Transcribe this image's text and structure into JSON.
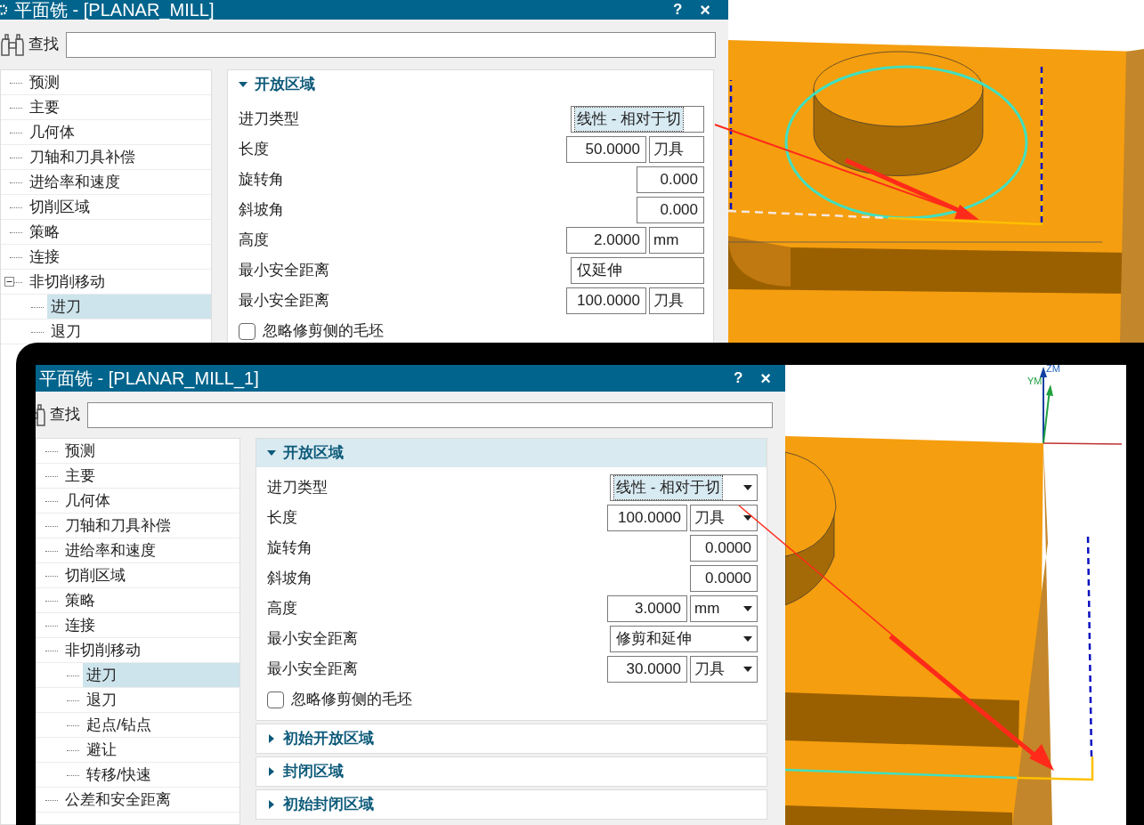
{
  "top_screen": {
    "dialog": {
      "title": "平面铣 - [PLANAR_MILL]",
      "help": "?",
      "close": "×",
      "search_label": "查找",
      "tree": [
        {
          "label": "预测",
          "selected": false
        },
        {
          "label": "主要",
          "selected": false
        },
        {
          "label": "几何体",
          "selected": false
        },
        {
          "label": "刀轴和刀具补偿",
          "selected": false
        },
        {
          "label": "进给率和速度",
          "selected": false
        },
        {
          "label": "切削区域",
          "selected": false
        },
        {
          "label": "策略",
          "selected": false
        },
        {
          "label": "连接",
          "selected": false
        },
        {
          "label": "非切削移动",
          "selected": false,
          "expanded": true,
          "children": [
            {
              "label": "进刀",
              "selected": true
            },
            {
              "label": "退刀",
              "selected": false
            }
          ]
        }
      ],
      "section": {
        "title": "开放区域",
        "expanded": true,
        "highlighted": false,
        "fields": [
          {
            "label": "进刀类型",
            "kind": "dropdown",
            "value": "线性 - 相对于切",
            "focused": true
          },
          {
            "label": "长度",
            "kind": "number_unit",
            "value": "50.0000",
            "unit": "刀具"
          },
          {
            "label": "旋转角",
            "kind": "number",
            "value": "0.000"
          },
          {
            "label": "斜坡角",
            "kind": "number",
            "value": "0.000"
          },
          {
            "label": "高度",
            "kind": "number_unit",
            "value": "2.0000",
            "unit": "mm"
          },
          {
            "label": "最小安全距离",
            "kind": "dropdown",
            "value": "仅延伸",
            "focused": false
          },
          {
            "label": "最小安全距离",
            "kind": "number_unit",
            "value": "100.0000",
            "unit": "刀具"
          }
        ],
        "checkbox": {
          "label": "忽略修剪侧的毛坯",
          "checked": false
        }
      }
    }
  },
  "bottom_screen": {
    "dialog": {
      "title": "平面铣 - [PLANAR_MILL_1]",
      "help": "?",
      "close": "×",
      "search_label": "查找",
      "tree": [
        {
          "label": "预测",
          "selected": false
        },
        {
          "label": "主要",
          "selected": false
        },
        {
          "label": "几何体",
          "selected": false
        },
        {
          "label": "刀轴和刀具补偿",
          "selected": false
        },
        {
          "label": "进给率和速度",
          "selected": false
        },
        {
          "label": "切削区域",
          "selected": false
        },
        {
          "label": "策略",
          "selected": false
        },
        {
          "label": "连接",
          "selected": false
        },
        {
          "label": "非切削移动",
          "selected": false,
          "children": [
            {
              "label": "进刀",
              "selected": true
            },
            {
              "label": "退刀",
              "selected": false
            },
            {
              "label": "起点/钻点",
              "selected": false
            },
            {
              "label": "避让",
              "selected": false
            },
            {
              "label": "转移/快速",
              "selected": false
            }
          ]
        },
        {
          "label": "公差和安全距离",
          "selected": false
        }
      ],
      "section": {
        "title": "开放区域",
        "expanded": true,
        "highlighted": true,
        "fields": [
          {
            "label": "进刀类型",
            "kind": "dropdown",
            "value": "线性 - 相对于切",
            "focused": true
          },
          {
            "label": "长度",
            "kind": "number_unit",
            "value": "100.0000",
            "unit": "刀具"
          },
          {
            "label": "旋转角",
            "kind": "number",
            "value": "0.0000"
          },
          {
            "label": "斜坡角",
            "kind": "number",
            "value": "0.0000"
          },
          {
            "label": "高度",
            "kind": "number_unit",
            "value": "3.0000",
            "unit": "mm"
          },
          {
            "label": "最小安全距离",
            "kind": "dropdown",
            "value": "修剪和延伸",
            "focused": false
          },
          {
            "label": "最小安全距离",
            "kind": "number_unit",
            "value": "30.0000",
            "unit": "刀具"
          }
        ],
        "checkbox": {
          "label": "忽略修剪侧的毛坯",
          "checked": false
        }
      },
      "collapsed_sections": [
        {
          "title": "初始开放区域",
          "expanded": false
        },
        {
          "title": "封闭区域",
          "expanded": false
        },
        {
          "title": "初始封闭区域",
          "expanded": false
        }
      ]
    },
    "viewport": {
      "axis_labels": [
        "ZM",
        "YM"
      ]
    }
  }
}
